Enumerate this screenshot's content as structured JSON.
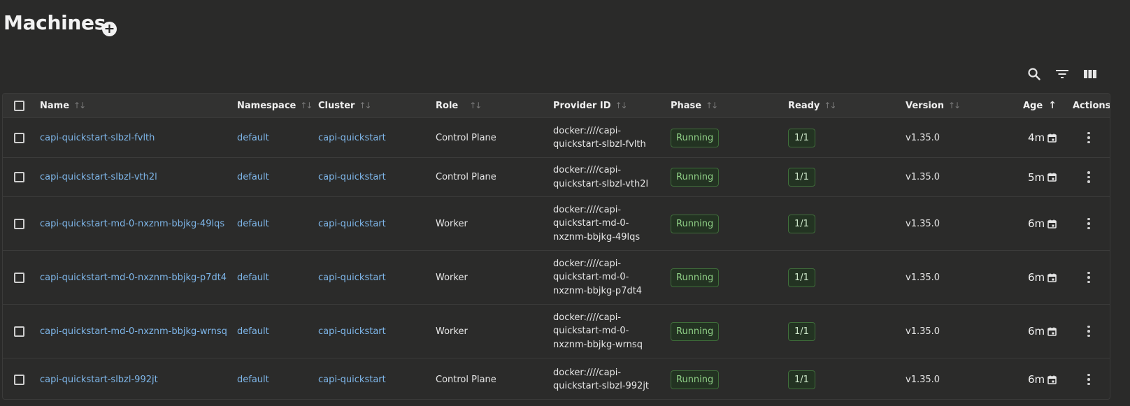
{
  "page": {
    "title": "Machines"
  },
  "icons": {
    "add": "plus-circle-icon",
    "search": "search-icon",
    "filter": "filter-icon",
    "columns": "columns-icon",
    "calendar": "calendar-icon",
    "more": "more-vertical-icon"
  },
  "colors": {
    "background": "#2a2a29",
    "link": "#7eb6e9",
    "status_running": "#8fcf86"
  },
  "table": {
    "columns": {
      "name": "Name",
      "namespace": "Namespace",
      "cluster": "Cluster",
      "role": "Role",
      "provider": "Provider ID",
      "phase": "Phase",
      "ready": "Ready",
      "version": "Version",
      "age": "Age",
      "actions": "Actions"
    },
    "sort": {
      "column": "Age",
      "direction": "ascending"
    },
    "rows": [
      {
        "name": "capi-quickstart-slbzl-fvlth",
        "namespace": "default",
        "cluster": "capi-quickstart",
        "role": "Control Plane",
        "provider_lines": [
          "docker:////capi-",
          "quickstart-slbzl-fvlth"
        ],
        "phase": "Running",
        "ready": "1/1",
        "version": "v1.35.0",
        "age": "4m"
      },
      {
        "name": "capi-quickstart-slbzl-vth2l",
        "namespace": "default",
        "cluster": "capi-quickstart",
        "role": "Control Plane",
        "provider_lines": [
          "docker:////capi-",
          "quickstart-slbzl-vth2l"
        ],
        "phase": "Running",
        "ready": "1/1",
        "version": "v1.35.0",
        "age": "5m"
      },
      {
        "name": "capi-quickstart-md-0-nxznm-bbjkg-49lqs",
        "namespace": "default",
        "cluster": "capi-quickstart",
        "role": "Worker",
        "provider_lines": [
          "docker:////capi-",
          "quickstart-md-0-",
          "nxznm-bbjkg-49lqs"
        ],
        "phase": "Running",
        "ready": "1/1",
        "version": "v1.35.0",
        "age": "6m"
      },
      {
        "name": "capi-quickstart-md-0-nxznm-bbjkg-p7dt4",
        "namespace": "default",
        "cluster": "capi-quickstart",
        "role": "Worker",
        "provider_lines": [
          "docker:////capi-",
          "quickstart-md-0-",
          "nxznm-bbjkg-p7dt4"
        ],
        "phase": "Running",
        "ready": "1/1",
        "version": "v1.35.0",
        "age": "6m"
      },
      {
        "name": "capi-quickstart-md-0-nxznm-bbjkg-wrnsq",
        "namespace": "default",
        "cluster": "capi-quickstart",
        "role": "Worker",
        "provider_lines": [
          "docker:////capi-",
          "quickstart-md-0-",
          "nxznm-bbjkg-wrnsq"
        ],
        "phase": "Running",
        "ready": "1/1",
        "version": "v1.35.0",
        "age": "6m"
      },
      {
        "name": "capi-quickstart-slbzl-992jt",
        "namespace": "default",
        "cluster": "capi-quickstart",
        "role": "Control Plane",
        "provider_lines": [
          "docker:////capi-",
          "quickstart-slbzl-992jt"
        ],
        "phase": "Running",
        "ready": "1/1",
        "version": "v1.35.0",
        "age": "6m"
      }
    ]
  }
}
